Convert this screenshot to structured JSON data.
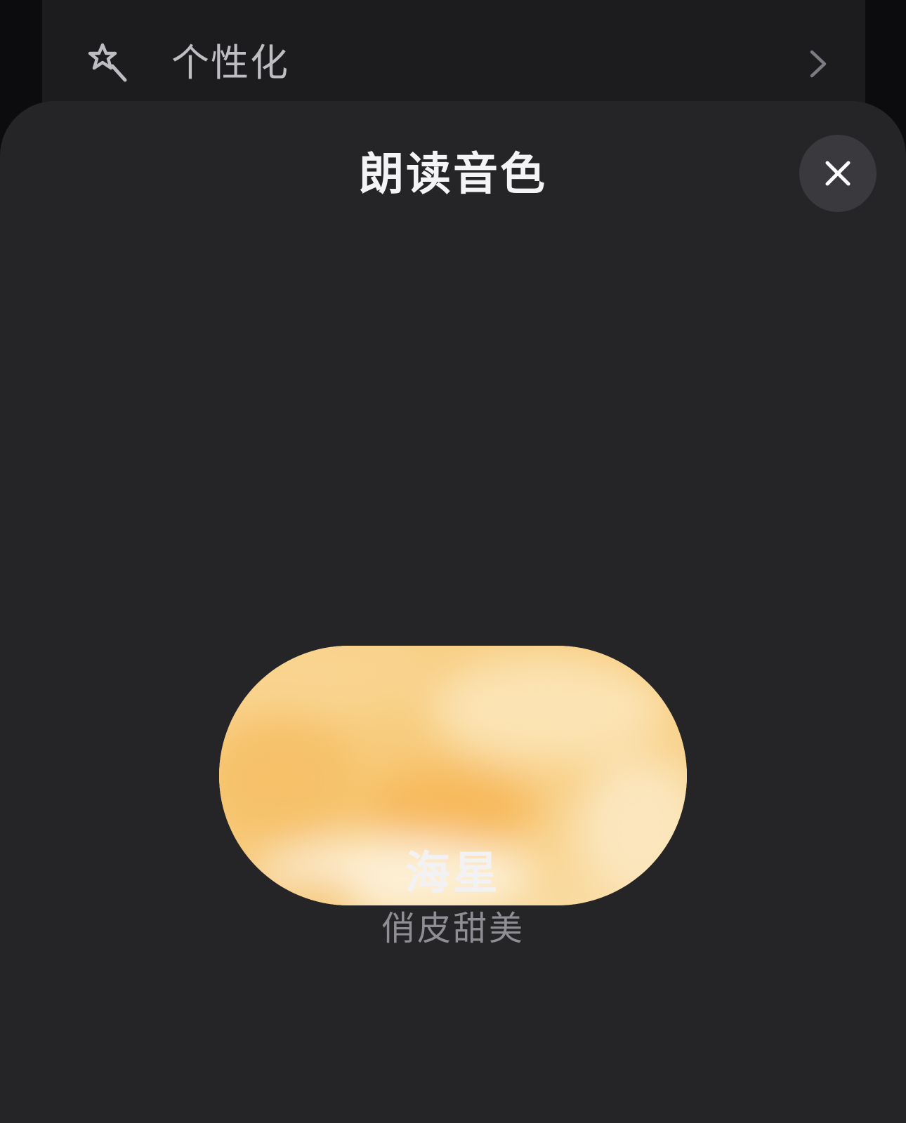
{
  "background": {
    "settings_row": {
      "label": "个性化",
      "icon": "sparkle-magnifier-icon",
      "chevron_icon": "chevron-right-icon"
    }
  },
  "sheet": {
    "title": "朗读音色",
    "close_icon": "close-icon",
    "voice": {
      "name": "海星",
      "description": "俏皮甜美",
      "swatch_colors": [
        "#f7cc7e",
        "#fbe3b3",
        "#f9b85e",
        "#fdf0d6"
      ]
    }
  },
  "colors": {
    "sheet_background": "#252528",
    "close_button_background": "#3a3a3e",
    "title_text": "#f4f4f6",
    "secondary_text": "#8e8e94"
  }
}
